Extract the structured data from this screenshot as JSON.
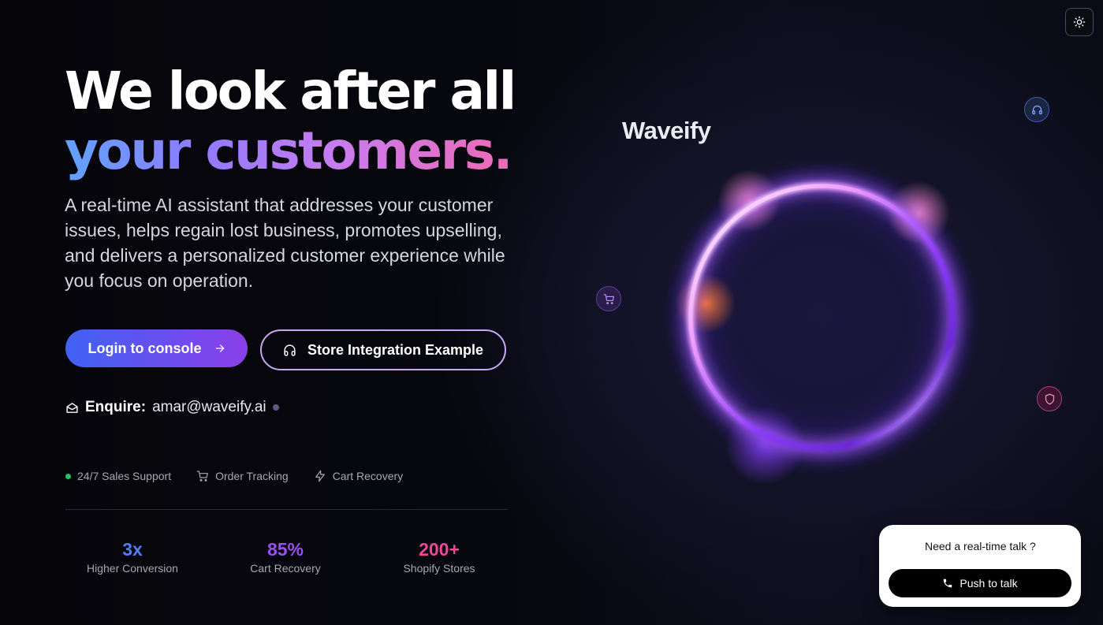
{
  "hero": {
    "title_line1": "We look after all",
    "title_line2": "your customers.",
    "description": "A real-time AI assistant that addresses your customer issues, helps regain lost business, promotes upselling, and delivers a personalized customer experience while you focus on operation."
  },
  "buttons": {
    "login_label": "Login to console",
    "store_label": "Store Integration Example"
  },
  "enquire": {
    "label": "Enquire:",
    "email": "amar@waveify.ai"
  },
  "features": [
    {
      "label": "24/7 Sales Support",
      "icon": "green-dot"
    },
    {
      "label": "Order Tracking",
      "icon": "cart-icon"
    },
    {
      "label": "Cart Recovery",
      "icon": "bolt-icon"
    }
  ],
  "stats": [
    {
      "value": "3x",
      "label": "Higher Conversion",
      "color": "#4f7ff0"
    },
    {
      "value": "85%",
      "label": "Cart Recovery",
      "color": "#9b4ff0"
    },
    {
      "value": "200+",
      "label": "Shopify Stores",
      "color": "#ec4899"
    }
  ],
  "brand": {
    "name": "Waveify"
  },
  "chat_widget": {
    "question": "Need a real-time talk ?",
    "button_label": "Push to talk"
  },
  "colors": {
    "accent_blue": "#3f63f2",
    "accent_purple": "#8b3fe8",
    "accent_pink": "#ec4899"
  }
}
